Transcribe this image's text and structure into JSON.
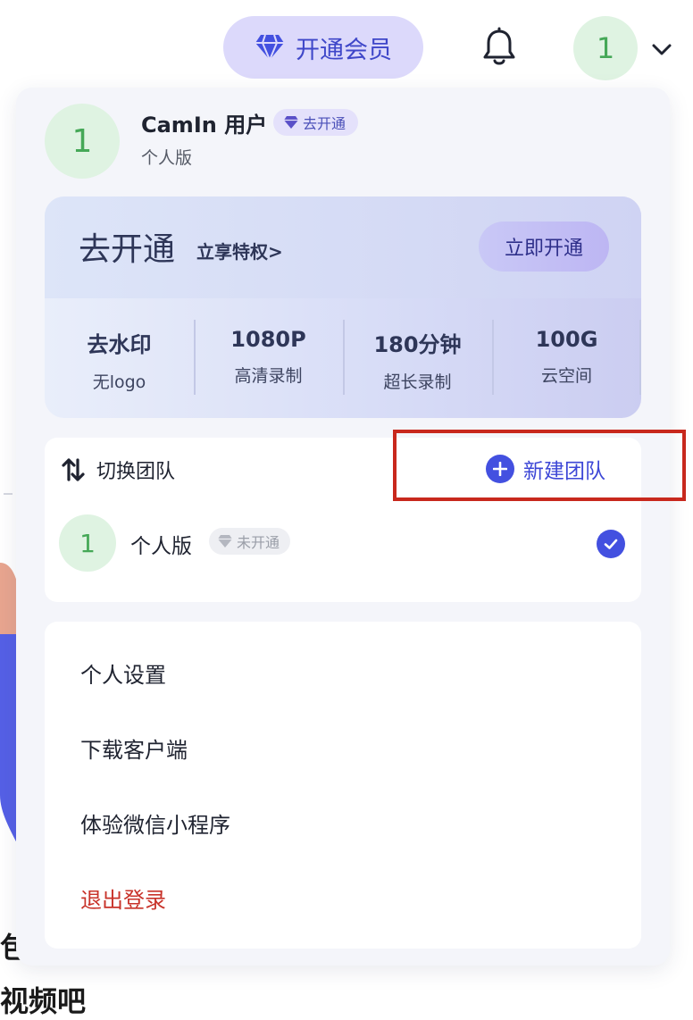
{
  "topbar": {
    "vip_label": "开通会员",
    "avatar_initial": "1"
  },
  "background": {
    "fragment_left": "包",
    "fragment_bottom": "视频吧"
  },
  "profile": {
    "avatar_initial": "1",
    "username": "CamIn 用户",
    "upgrade_badge": "去开通",
    "plan": "个人版"
  },
  "promo": {
    "title": "去开通",
    "subtitle": "立享特权>",
    "button": "立即开通",
    "perks": [
      {
        "value": "去水印",
        "label": "无logo"
      },
      {
        "value": "1080P",
        "label": "高清录制"
      },
      {
        "value": "180分钟",
        "label": "超长录制"
      },
      {
        "value": "100G",
        "label": "云空间"
      }
    ]
  },
  "team": {
    "switch_label": "切换团队",
    "new_team_label": "新建团队",
    "items": [
      {
        "initial": "1",
        "name": "个人版",
        "badge": "未开通",
        "selected": true
      }
    ]
  },
  "menu": {
    "items": [
      "个人设置",
      "下载客户端",
      "体验微信小程序"
    ],
    "logout": "退出登录"
  },
  "colors": {
    "accent": "#4350e0",
    "vip_bg": "#dcd9fb",
    "avatar_bg": "#dff3e2",
    "avatar_text": "#45a857",
    "logout": "#c8332a",
    "highlight_box": "#c8281d"
  }
}
